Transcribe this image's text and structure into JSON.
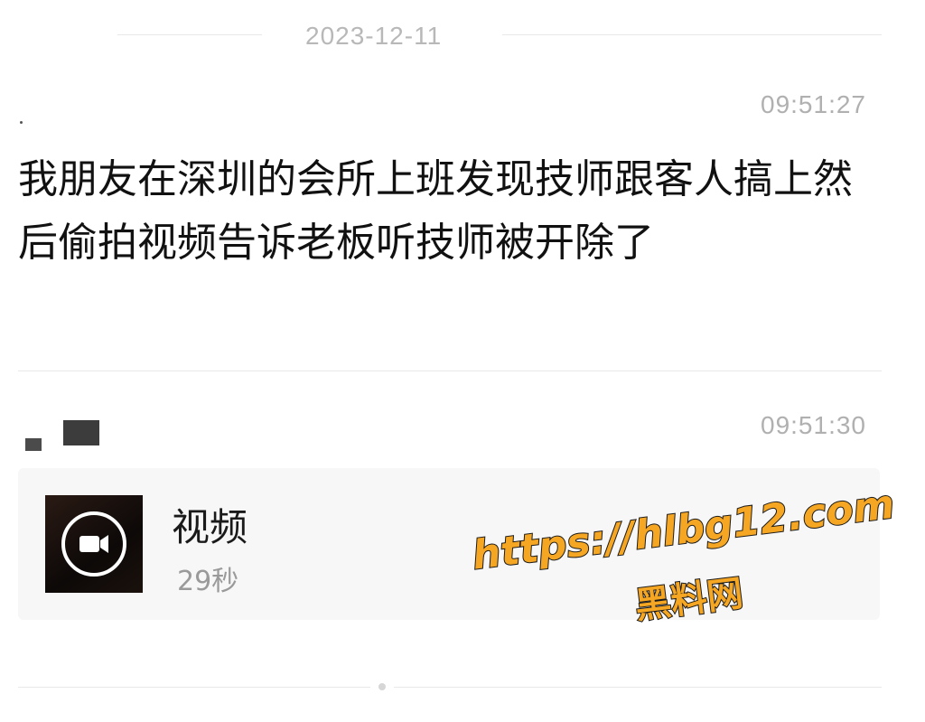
{
  "chat": {
    "date_separator": "2023-12-11",
    "messages": [
      {
        "time": "09:51:27",
        "text": "我朋友在深圳的会所上班发现技师跟客人搞上然后偷拍视频告诉老板听技师被开除了"
      },
      {
        "time": "09:51:30",
        "video": {
          "title": "视频",
          "duration": "29秒",
          "icon": "video-camera-icon"
        }
      }
    ]
  },
  "watermark": {
    "url": "https://hlbg12.com",
    "name": "黑料网",
    "color": "#f5a623"
  }
}
